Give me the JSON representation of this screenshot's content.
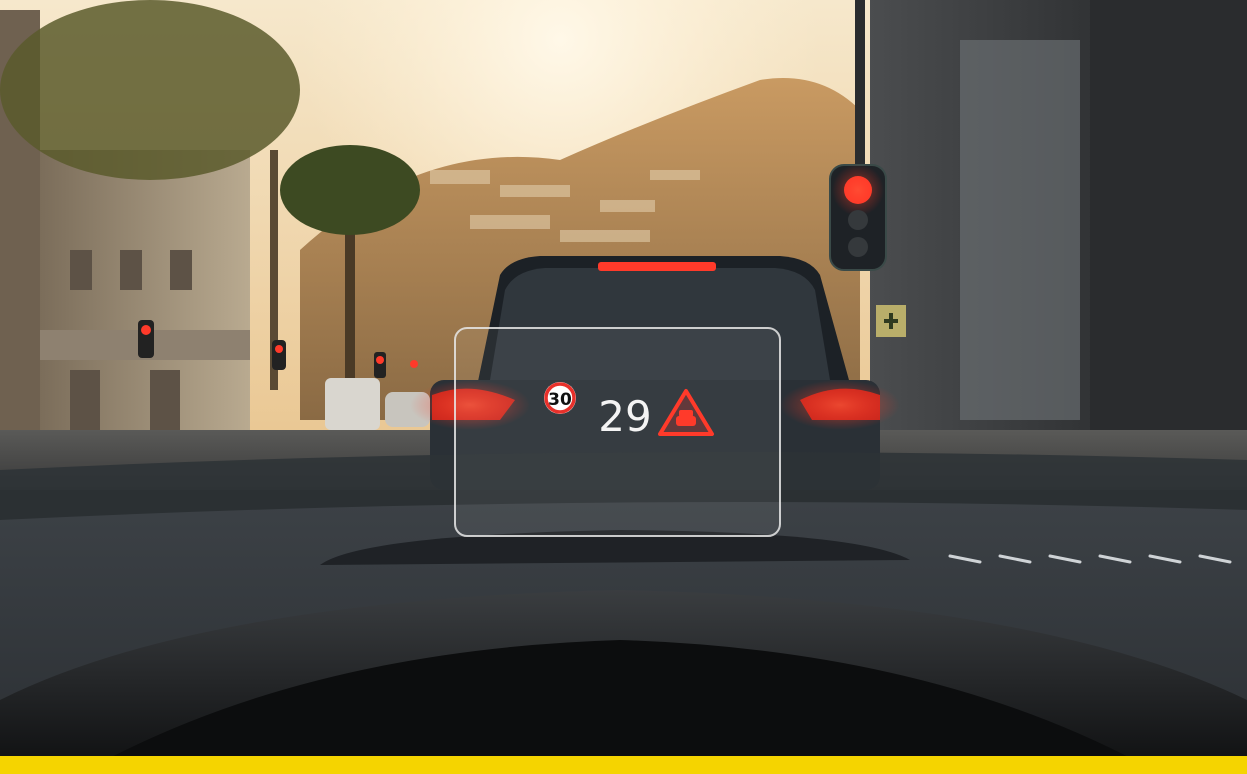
{
  "hud": {
    "speed_limit": "30",
    "current_speed": "29",
    "warning_icon": "car-collision-warning-icon"
  },
  "colors": {
    "accent_bar": "#f5d400",
    "hud_red": "#e8302a",
    "hud_white": "#f4f4f4",
    "traffic_red": "#ff3a2a"
  }
}
